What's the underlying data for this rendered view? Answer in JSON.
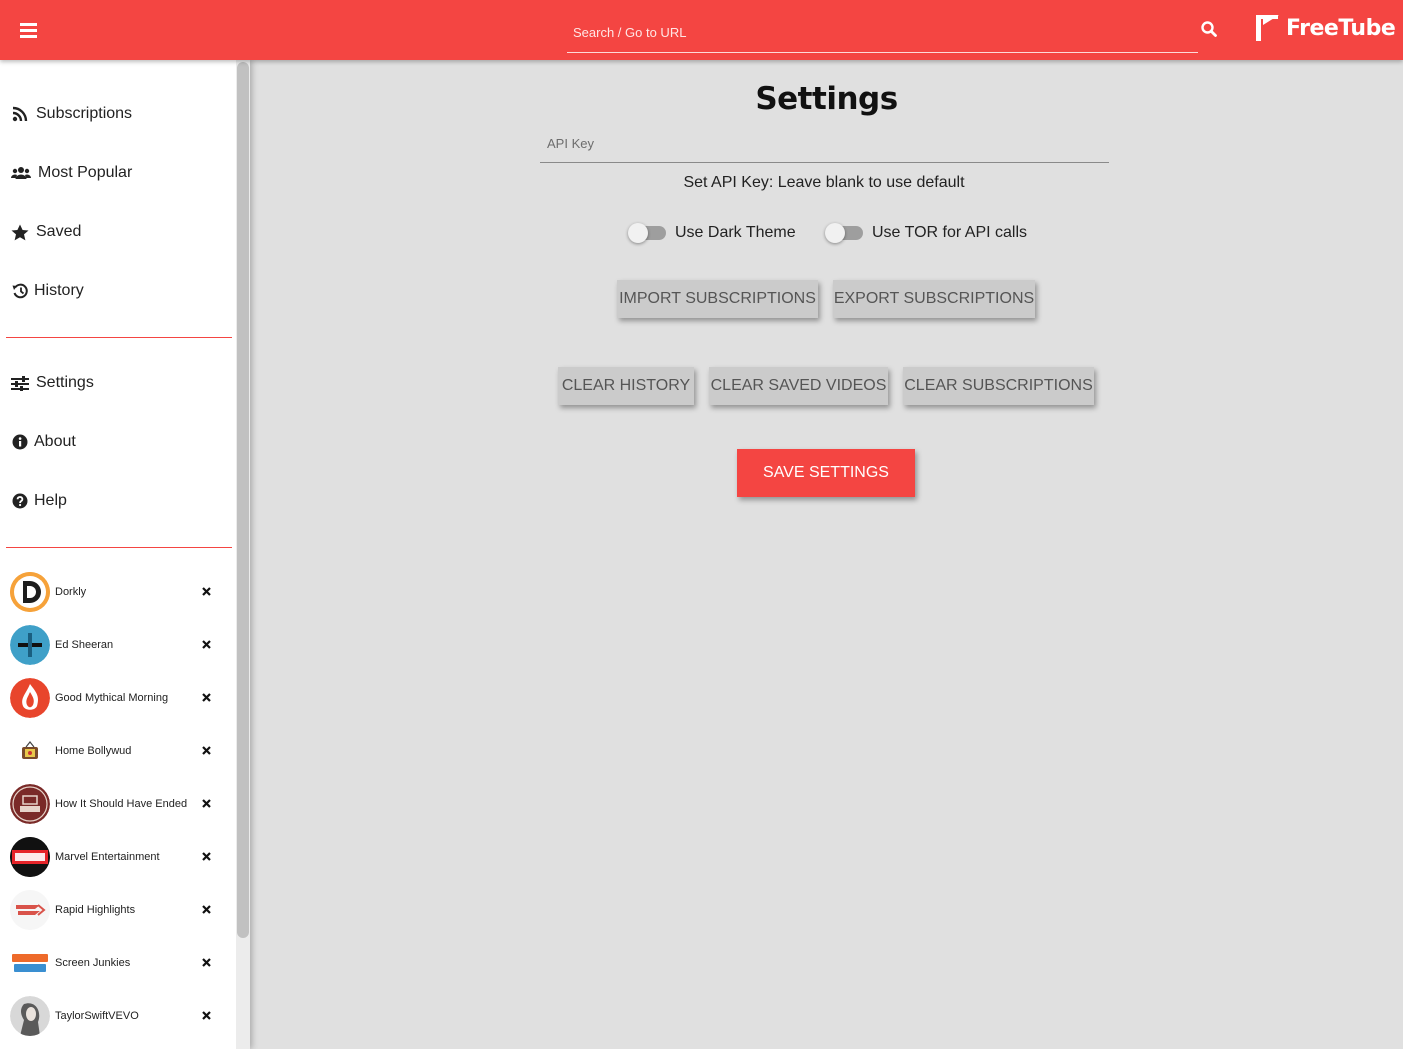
{
  "header": {
    "search_placeholder": "Search / Go to URL",
    "logo_text": "FreeTube",
    "brand_color": "#f44542"
  },
  "sidebar": {
    "nav": [
      {
        "label": "Subscriptions",
        "icon": "rss-icon"
      },
      {
        "label": "Most Popular",
        "icon": "users-icon"
      },
      {
        "label": "Saved",
        "icon": "star-icon"
      },
      {
        "label": "History",
        "icon": "history-icon"
      }
    ],
    "nav2": [
      {
        "label": "Settings",
        "icon": "sliders-icon"
      },
      {
        "label": "About",
        "icon": "info-icon"
      },
      {
        "label": "Help",
        "icon": "question-icon"
      }
    ],
    "subscriptions": [
      {
        "name": "Dorkly"
      },
      {
        "name": "Ed Sheeran"
      },
      {
        "name": "Good Mythical Morning"
      },
      {
        "name": "Home Bollywud"
      },
      {
        "name": "How It Should Have Ended"
      },
      {
        "name": "Marvel Entertainment"
      },
      {
        "name": "Rapid Highlights"
      },
      {
        "name": "Screen Junkies"
      },
      {
        "name": "TaylorSwiftVEVO"
      }
    ]
  },
  "settings": {
    "title": "Settings",
    "api_key_placeholder": "API Key",
    "api_key_value": "",
    "api_help": "Set API Key: Leave blank to use default",
    "toggles": [
      {
        "label": "Use Dark Theme",
        "on": false
      },
      {
        "label": "Use TOR for API calls",
        "on": false
      }
    ],
    "buttons": {
      "import_subs": "Import Subscriptions",
      "export_subs": "Export Subscriptions",
      "clear_history": "Clear History",
      "clear_saved": "Clear Saved Videos",
      "clear_subs": "Clear Subscriptions",
      "save": "Save Settings"
    }
  }
}
